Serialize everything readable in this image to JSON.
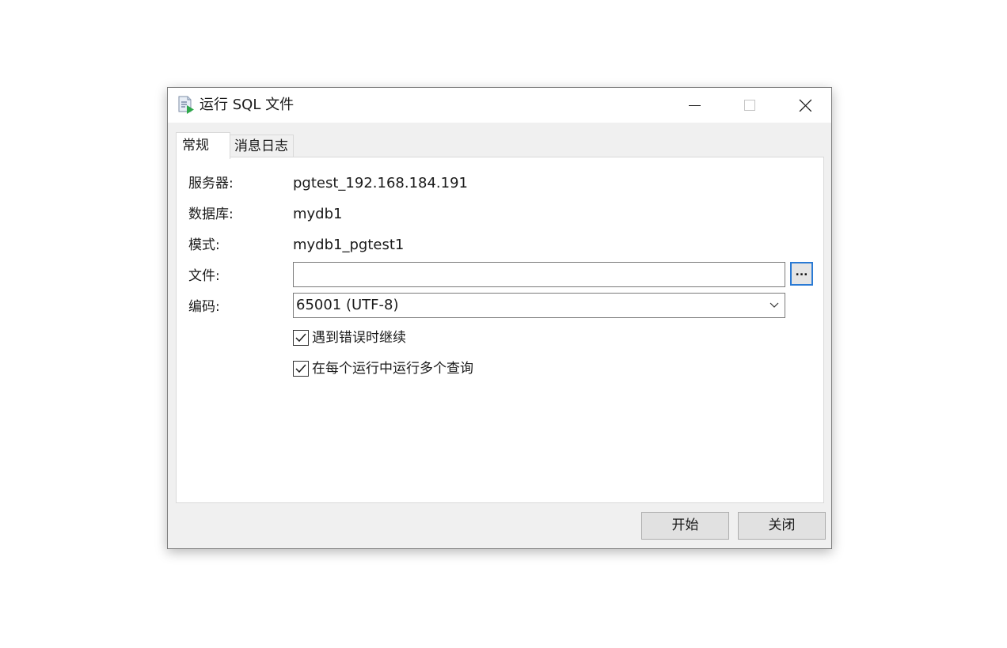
{
  "window": {
    "title": "运行 SQL 文件",
    "app_icon": "sql-file-run-icon"
  },
  "tabs": [
    {
      "label": "常规",
      "active": true
    },
    {
      "label": "消息日志",
      "active": false
    }
  ],
  "form": {
    "server_label": "服务器:",
    "server_value": "pgtest_192.168.184.191",
    "database_label": "数据库:",
    "database_value": "mydb1",
    "schema_label": "模式:",
    "schema_value": "mydb1_pgtest1",
    "file_label": "文件:",
    "file_value": "",
    "browse_label": "...",
    "encoding_label": "编码:",
    "encoding_value": "65001 (UTF-8)",
    "continue_on_error_label": "遇到错误时继续",
    "continue_on_error_checked": true,
    "multiple_queries_label": "在每个运行中运行多个查询",
    "multiple_queries_checked": true
  },
  "buttons": {
    "start": "开始",
    "close": "关闭"
  },
  "colors": {
    "window_bg": "#f0f0f0",
    "panel_bg": "#ffffff",
    "focus_border": "#2a7ad4",
    "icon_green": "#2ea84a"
  }
}
